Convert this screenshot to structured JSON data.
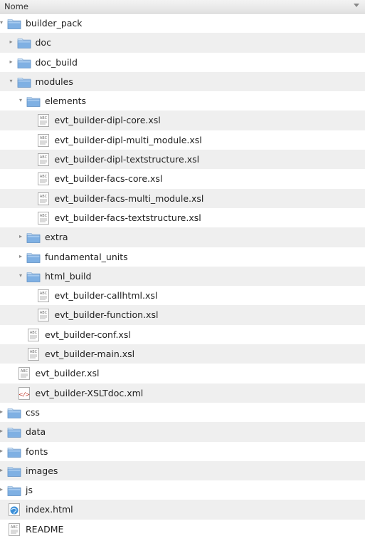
{
  "header": {
    "column_label": "Nome"
  },
  "rows": [
    {
      "label": "builder_pack",
      "type": "folder",
      "level": 0,
      "expanded": true
    },
    {
      "label": "doc",
      "type": "folder",
      "level": 1,
      "expanded": false
    },
    {
      "label": "doc_build",
      "type": "folder",
      "level": 1,
      "expanded": false
    },
    {
      "label": "modules",
      "type": "folder",
      "level": 1,
      "expanded": true
    },
    {
      "label": "elements",
      "type": "folder",
      "level": 2,
      "expanded": true
    },
    {
      "label": "evt_builder-dipl-core.xsl",
      "type": "xsl",
      "level": 3
    },
    {
      "label": "evt_builder-dipl-multi_module.xsl",
      "type": "xsl",
      "level": 3
    },
    {
      "label": "evt_builder-dipl-textstructure.xsl",
      "type": "xsl",
      "level": 3
    },
    {
      "label": "evt_builder-facs-core.xsl",
      "type": "xsl",
      "level": 3
    },
    {
      "label": "evt_builder-facs-multi_module.xsl",
      "type": "xsl",
      "level": 3
    },
    {
      "label": "evt_builder-facs-textstructure.xsl",
      "type": "xsl",
      "level": 3
    },
    {
      "label": "extra",
      "type": "folder",
      "level": 2,
      "expanded": false
    },
    {
      "label": "fundamental_units",
      "type": "folder",
      "level": 2,
      "expanded": false
    },
    {
      "label": "html_build",
      "type": "folder",
      "level": 2,
      "expanded": true
    },
    {
      "label": "evt_builder-callhtml.xsl",
      "type": "xsl",
      "level": 3
    },
    {
      "label": "evt_builder-function.xsl",
      "type": "xsl",
      "level": 3
    },
    {
      "label": "evt_builder-conf.xsl",
      "type": "xsl",
      "level": 2
    },
    {
      "label": "evt_builder-main.xsl",
      "type": "xsl",
      "level": 2
    },
    {
      "label": "evt_builder.xsl",
      "type": "xsl",
      "level": 1
    },
    {
      "label": "evt_builder-XSLTdoc.xml",
      "type": "xml",
      "level": 1
    },
    {
      "label": "css",
      "type": "folder",
      "level": 0,
      "expanded": false
    },
    {
      "label": "data",
      "type": "folder",
      "level": 0,
      "expanded": false
    },
    {
      "label": "fonts",
      "type": "folder",
      "level": 0,
      "expanded": false
    },
    {
      "label": "images",
      "type": "folder",
      "level": 0,
      "expanded": false
    },
    {
      "label": "js",
      "type": "folder",
      "level": 0,
      "expanded": false
    },
    {
      "label": "index.html",
      "type": "html",
      "level": 0
    },
    {
      "label": "README",
      "type": "text",
      "level": 0
    }
  ],
  "icons": {
    "folder": "folder-icon",
    "xsl": "text-document-icon",
    "text": "text-document-icon",
    "xml": "xml-document-icon",
    "html": "html-document-icon",
    "expander_open": "expander-open-icon",
    "expander_closed": "expander-closed-icon"
  },
  "colors": {
    "folder_top": "#c9dff5",
    "folder_body": "#7fb0e3",
    "row_stripe": "#efefef",
    "xml_tag": "#c0392b",
    "html_globe": "#3b8fd8"
  }
}
